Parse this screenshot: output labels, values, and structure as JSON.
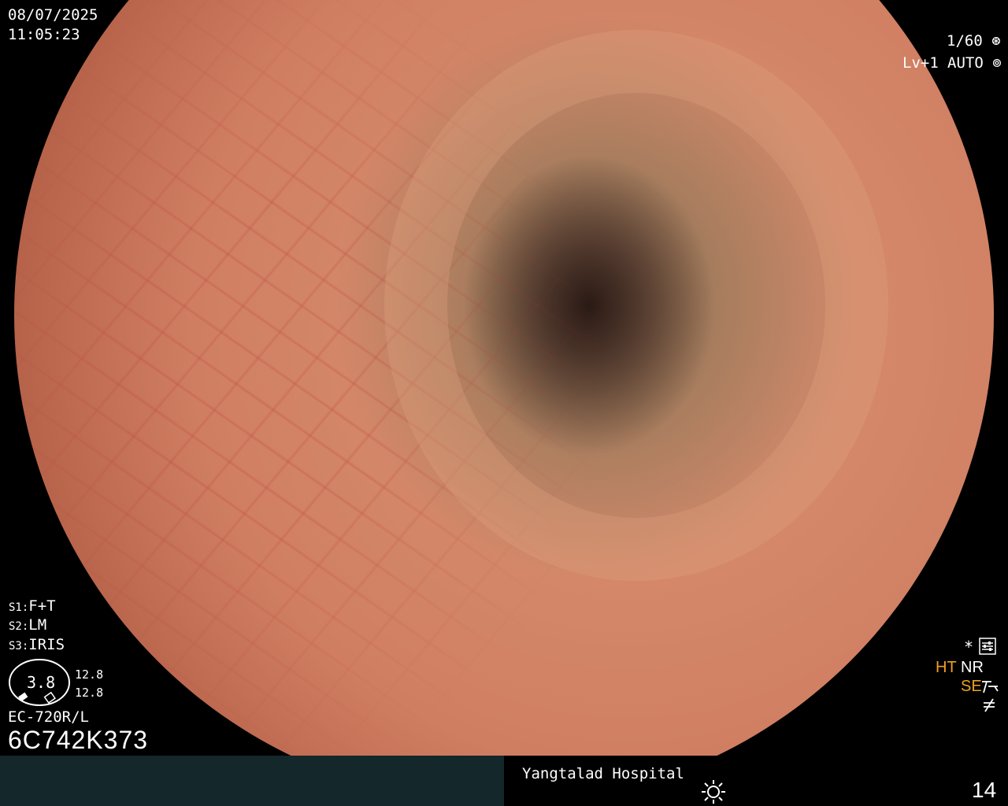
{
  "overlay": {
    "date": "08/07/2025",
    "time": "11:05:23",
    "shutter": "1/60",
    "level": "Lv+1",
    "mode": "AUTO",
    "s1": {
      "key": "S1:",
      "value": "F+T"
    },
    "s2": {
      "key": "S2:",
      "value": "LM"
    },
    "s3": {
      "key": "S3:",
      "value": "IRIS"
    },
    "gauge_value": "3.8",
    "gauge_top": "12.8",
    "gauge_bottom": "12.8",
    "scope_model": "EC-720R/L",
    "serial": "6C742K373",
    "ht": "HT",
    "nr": "NR",
    "se": "SE",
    "asterisk": "*"
  },
  "footer": {
    "hospital": "Yangtalad Hospital",
    "number": "14"
  },
  "colors": {
    "highlight": "#f0a020",
    "footer_left": "#14272a"
  }
}
